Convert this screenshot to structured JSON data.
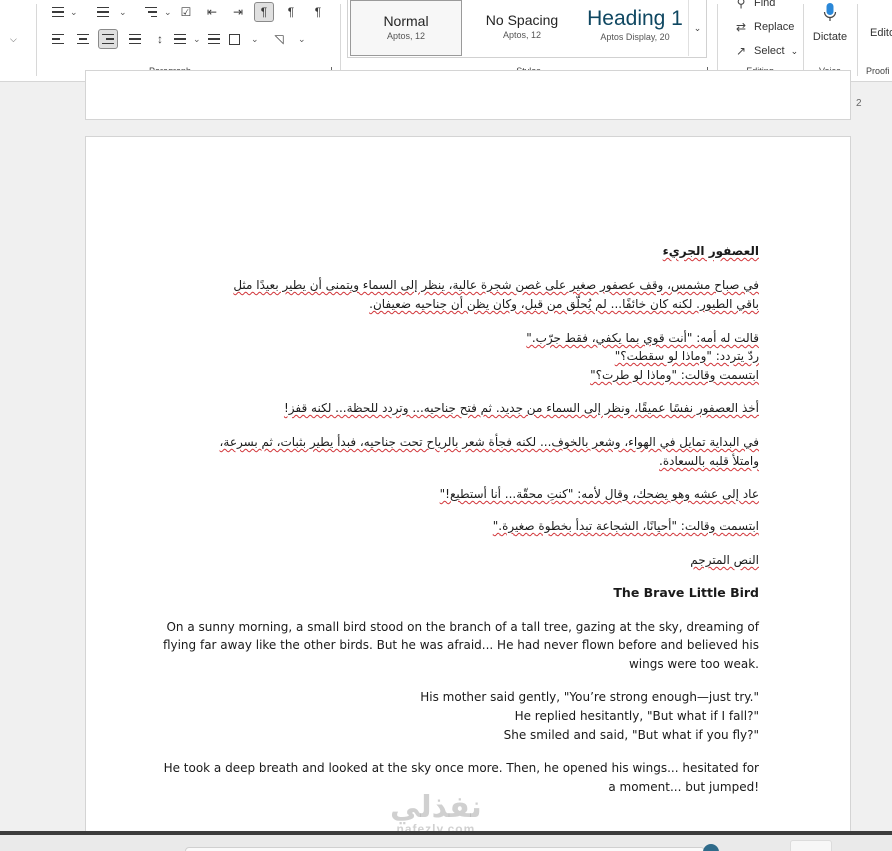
{
  "ribbon": {
    "paragraph_label": "Paragraph",
    "styles_label": "Styles",
    "editing_label": "Editing",
    "voice_label": "Voice",
    "proofing_label": "Proofi",
    "styles": [
      {
        "name": "Normal",
        "font": "Aptos, 12"
      },
      {
        "name": "No Spacing",
        "font": "Aptos, 12"
      },
      {
        "name": "Heading 1",
        "font": "Aptos Display, 20"
      }
    ],
    "editing": {
      "find": "Find",
      "replace": "Replace",
      "select": "Select"
    },
    "dictate": "Dictate",
    "editor": "Edito",
    "heading_color": "#0f4761",
    "icons": [
      "bullets-icon",
      "numbering-icon",
      "multilevel-list-icon",
      "checklist-icon",
      "decrease-indent-icon",
      "increase-indent-icon",
      "ltr-paragraph-icon",
      "rtl-paragraph-icon",
      "show-marks-icon",
      "align-left-icon",
      "align-center-icon",
      "align-right-icon",
      "justify-icon",
      "line-spacing-icon",
      "borders-icon",
      "shading-icon",
      "find-icon",
      "replace-icon",
      "select-icon",
      "microphone-icon"
    ]
  },
  "document": {
    "page_number": "2",
    "arabic": {
      "title": "العصفور الجريء",
      "p1": [
        "في صباح مشمس، وقف عصفور صغير على غصن شجرة عالية، ينظر إلى السماء ويتمنى أن يطير بعيدًا مثل",
        "باقي الطيور. لكنه كان خائفًا... لم يُحلّق من قبل، وكان يظن أن جناحيه ضعيفان."
      ],
      "d1": "قالت له أمه: \"أنت قوي بما يكفي، فقط جرّب.\"",
      "d2": "ردّ يتردد: \"وماذا لو سقطت؟\"",
      "d3": "ابتسمت وقالت: \"وماذا لو طرت؟\"",
      "p2": "أخذ العصفور نفسًا عميقًا، ونظر إلى السماء من جديد. ثم فتح جناحيه... وتردد للحظة... لكنه قفز!",
      "p3": [
        "في البداية تمايل في الهواء، وشعر بالخوف... لكنه فجأة شعر بالرياح تحت جناحيه، فبدأ يطير بثبات، ثم بسرعة،",
        "وامتلأ قلبه بالسعادة."
      ],
      "p4": "عاد إلى عشه وهو يضحك، وقال لأمه: \"كنتِ محقّة... أنا أستطيع!\"",
      "p5": "ابتسمت وقالت: \"أحيانًا، الشجاعة تبدأ بخطوة صغيرة.\"",
      "translated_label": "النص المترجم"
    },
    "english": {
      "title": "The Brave Little Bird",
      "p1": [
        "On a sunny morning, a small bird stood on the branch of a tall tree, gazing at the sky, dreaming of",
        "flying far away like the other birds. But he was afraid... He had never flown before and believed his",
        "wings were too weak."
      ],
      "d1": "His mother said gently, \"You’re strong enough—just try.\"",
      "d2": "He replied hesitantly, \"But what if I fall?\"",
      "d3": "She smiled and said, \"But what if you fly?\"",
      "p2": [
        "He took a deep breath and looked at the sky once more. Then, he opened his wings... hesitated for",
        "a moment... but jumped!"
      ]
    }
  },
  "watermark": {
    "ar": "نفذلي",
    "en": "nafezly.com"
  }
}
